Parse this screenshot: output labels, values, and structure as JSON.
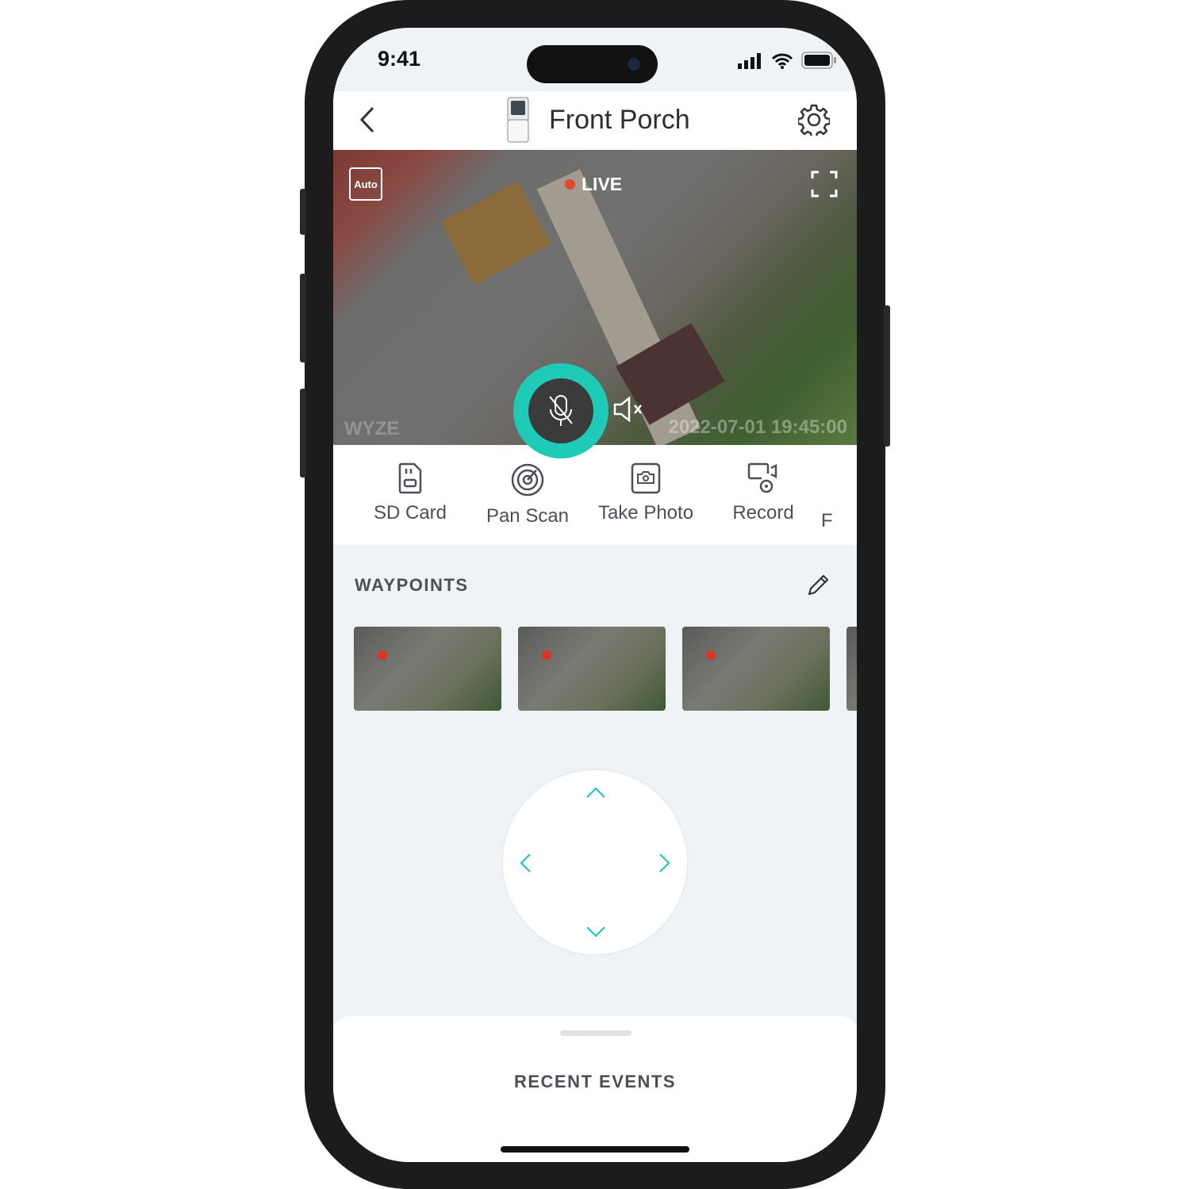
{
  "status_bar": {
    "time": "9:41"
  },
  "header": {
    "title": "Front Porch"
  },
  "video": {
    "quality": "Auto",
    "live_label": "LIVE",
    "timestamp": "2022-07-01 19:45:00",
    "watermark": "WYZE",
    "mic_muted": true,
    "speaker_muted": true
  },
  "actions": [
    {
      "label": "SD Card",
      "icon": "sd-card-icon"
    },
    {
      "label": "Pan Scan",
      "icon": "target-icon"
    },
    {
      "label": "Take Photo",
      "icon": "camera-icon"
    },
    {
      "label": "Record",
      "icon": "record-icon"
    },
    {
      "label": "F",
      "icon": ""
    }
  ],
  "waypoints": {
    "title": "WAYPOINTS",
    "count_visible": 4
  },
  "recent_events": {
    "title": "RECENT EVENTS"
  },
  "colors": {
    "accent": "#1ecbb6",
    "live_dot": "#e4472c",
    "text": "#4b5057"
  }
}
